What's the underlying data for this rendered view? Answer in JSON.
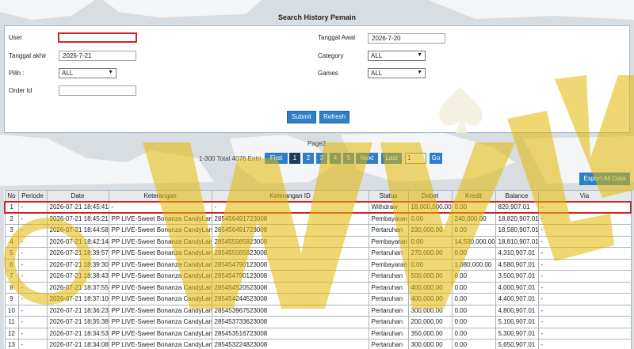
{
  "page_title": "Search History Pemain",
  "form": {
    "user_label": "User",
    "user_value": "",
    "tanggal_akhir_label": "Tanggal akhir",
    "tanggal_akhir_value": "2026-7-21",
    "pilih_label": "Pilih  :",
    "pilih_value": "ALL",
    "order_id_label": "Order Id",
    "order_id_value": "",
    "tanggal_awal_label": "Tanggal Awal",
    "tanggal_awal_value": "2026-7-20",
    "category_label": "Category",
    "category_value": "ALL",
    "games_label": "Games",
    "games_value": "ALL",
    "submit_label": "Submit",
    "refresh_label": "Refresh"
  },
  "pager": {
    "page_label": "Page2",
    "summary": "1-300 Total 4076 Entri",
    "first": "First",
    "pages": [
      "1",
      "2",
      "3",
      "4",
      "5"
    ],
    "active_page": "1",
    "next": "Next",
    "last": "Last",
    "goto_value": "1",
    "go": "Go"
  },
  "export_label": "Export All Data",
  "table": {
    "headers": [
      "No",
      "Periode",
      "Date",
      "Keterangan",
      "Keterangan ID",
      "Status",
      "Debet",
      "Kredit",
      "Balance",
      "Via"
    ],
    "rows": [
      [
        "1",
        "-",
        "2026-07-21 18:45:41",
        "-",
        "-",
        "Withdraw",
        "18,000,000.00",
        "0.00",
        "820,907.01",
        "-"
      ],
      [
        "2",
        "-",
        "2026-07-21 18:45:21",
        "PP LIVE-Sweet Bonanza CandyLand",
        "285456491723008",
        "Pembayaran",
        "0.00",
        "240,000.00",
        "18,820,907.01",
        "-"
      ],
      [
        "3",
        "-",
        "2026-07-21 18:44:58",
        "PP LIVE-Sweet Bonanza CandyLand",
        "285456491723008",
        "Pertaruhan",
        "230,000.00",
        "0.00",
        "18,580,907.01",
        "-"
      ],
      [
        "4",
        "-",
        "2026-07-21 18:42:14",
        "PP LIVE-Sweet Bonanza CandyLand",
        "285455085823008",
        "Pembayaran",
        "0.00",
        "14,500,000.00",
        "18,810,907.01",
        "-"
      ],
      [
        "5",
        "-",
        "2026-07-21 18:39:57",
        "PP LIVE-Sweet Bonanza CandyLand",
        "285455085823008",
        "Pertaruhan",
        "270,000.00",
        "0.00",
        "4,310,907.01",
        "-"
      ],
      [
        "6",
        "-",
        "2026-07-21 18:39:30",
        "PP LIVE-Sweet Bonanza CandyLand",
        "285454790123008",
        "Pembayaran",
        "0.00",
        "1,080,000.00",
        "4,580,907.01",
        "-"
      ],
      [
        "7",
        "-",
        "2026-07-21 18:38:43",
        "PP LIVE-Sweet Bonanza CandyLand",
        "285454790123008",
        "Pertaruhan",
        "500,000.00",
        "0.00",
        "3,500,907.01",
        "-"
      ],
      [
        "8",
        "-",
        "2026-07-21 18:37:55",
        "PP LIVE-Sweet Bonanza CandyLand",
        "285454520523008",
        "Pertaruhan",
        "400,000.00",
        "0.00",
        "4,000,907.01",
        "-"
      ],
      [
        "9",
        "-",
        "2026-07-21 18:37:10",
        "PP LIVE-Sweet Bonanza CandyLand",
        "285454244523008",
        "Pertaruhan",
        "400,000.00",
        "0.00",
        "4,400,907.01",
        "-"
      ],
      [
        "10",
        "-",
        "2026-07-21 18:36:23",
        "PP LIVE-Sweet Bonanza CandyLand",
        "285453967523008",
        "Pertaruhan",
        "300,000.00",
        "0.00",
        "4,800,907.01",
        "-"
      ],
      [
        "11",
        "-",
        "2026-07-21 18:35:38",
        "PP LIVE-Sweet Bonanza CandyLand",
        "285453733623008",
        "Pertaruhan",
        "200,000.00",
        "0.00",
        "5,100,907.01",
        "-"
      ],
      [
        "12",
        "-",
        "2026-07-21 18:34:53",
        "PP LIVE-Sweet Bonanza CandyLand",
        "285453516723008",
        "Pertaruhan",
        "350,000.00",
        "0.00",
        "5,300,907.01",
        "-"
      ],
      [
        "13",
        "-",
        "2026-07-21 18:34:08",
        "PP LIVE-Sweet Bonanza CandyLand",
        "285453224823008",
        "Pertaruhan",
        "300,000.00",
        "0.00",
        "5,650,907.01",
        "-"
      ]
    ]
  },
  "colors": {
    "accent": "#2f7fc8",
    "highlight": "#c8282a",
    "link": "#3a7ab8",
    "watermark": "#e2b800"
  },
  "icons": {
    "select_arrow": "chevron-down-icon",
    "watermark": "brand-watermark-logo"
  }
}
